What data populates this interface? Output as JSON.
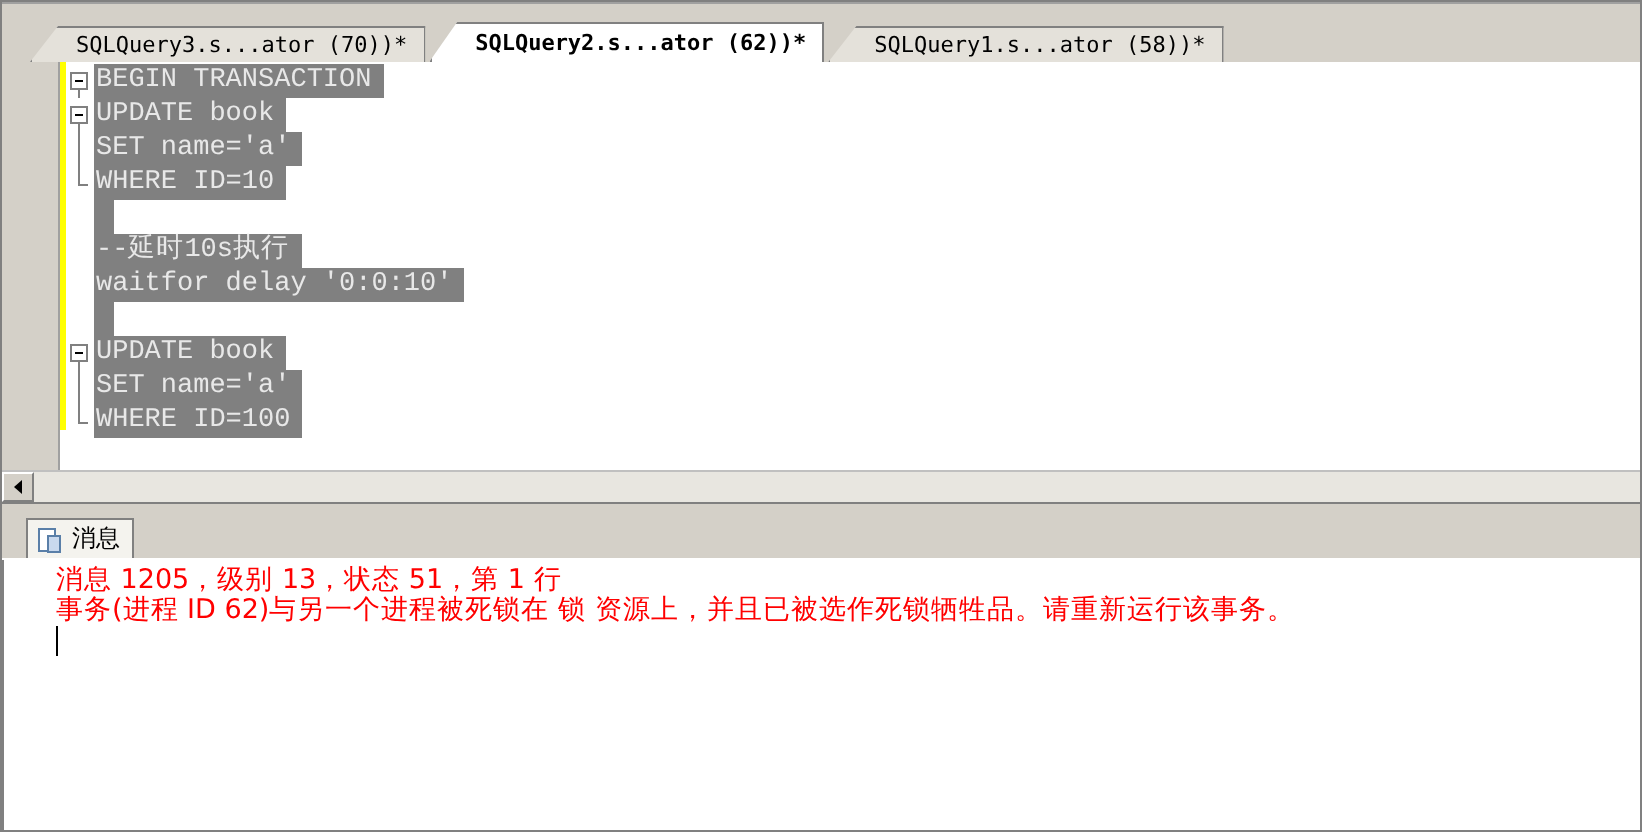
{
  "tabs": [
    {
      "label": "SQLQuery3.s...ator (70))*",
      "selected": false
    },
    {
      "label": "SQLQuery2.s...ator (62))*",
      "selected": true
    },
    {
      "label": "SQLQuery1.s...ator (58))*",
      "selected": false
    }
  ],
  "editor": {
    "lines": [
      {
        "text": "BEGIN TRANSACTION",
        "kind": "start",
        "selected": true
      },
      {
        "text": "UPDATE book",
        "kind": "start",
        "selected": true
      },
      {
        "text": "SET name='a'",
        "kind": "mid",
        "selected": true
      },
      {
        "text": "WHERE ID=10",
        "kind": "end",
        "selected": true
      },
      {
        "kind": "plain",
        "selected": true
      },
      {
        "text": "--延时10s执行",
        "kind": "plain",
        "selected": true
      },
      {
        "text": "waitfor delay '0:0:10'",
        "kind": "plain",
        "selected": true
      },
      {
        "kind": "plain",
        "selected": true
      },
      {
        "text": "UPDATE book",
        "kind": "start",
        "selected": true
      },
      {
        "text": "SET name='a'",
        "kind": "mid",
        "selected": true
      },
      {
        "text": "WHERE ID=100",
        "kind": "end",
        "selected": true
      }
    ]
  },
  "results": {
    "tab": {
      "label": "消息",
      "selected": true
    },
    "messages": [
      "消息 1205，级别 13，状态 51，第 1 行",
      "事务(进程 ID 62)与另一个进程被死锁在 锁 资源上，并且已被选作死锁牺牲品。请重新运行该事务。"
    ]
  }
}
